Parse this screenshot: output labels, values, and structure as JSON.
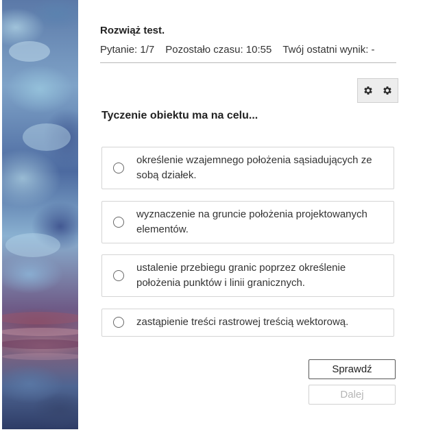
{
  "header": {
    "title": "Rozwiąż test.",
    "question_counter": "Pytanie: 1/7",
    "time_left": "Pozostało czasu: 10:55",
    "last_score": "Twój ostatni wynik: -"
  },
  "settings": {
    "icons": [
      "gear-icon",
      "gear-icon"
    ]
  },
  "question": {
    "text": "Tyczenie obiektu ma na celu..."
  },
  "answers": [
    {
      "text": "określenie wzajemnego położenia sąsiadujących ze sobą działek.",
      "selected": false
    },
    {
      "text": "wyznaczenie na gruncie położenia projektowanych elementów.",
      "selected": false
    },
    {
      "text": "ustalenie przebiegu granic poprzez określenie położenia punktów i linii granicznych.",
      "selected": false
    },
    {
      "text": "zastąpienie treści rastrowej treścią wektorową.",
      "selected": false
    }
  ],
  "buttons": {
    "check_label": "Sprawdź",
    "next_label": "Dalej",
    "next_disabled": true
  },
  "colors": {
    "border": "#d4d4d4",
    "disabled_text": "#b5b5b5",
    "settings_bg": "#ededed"
  }
}
